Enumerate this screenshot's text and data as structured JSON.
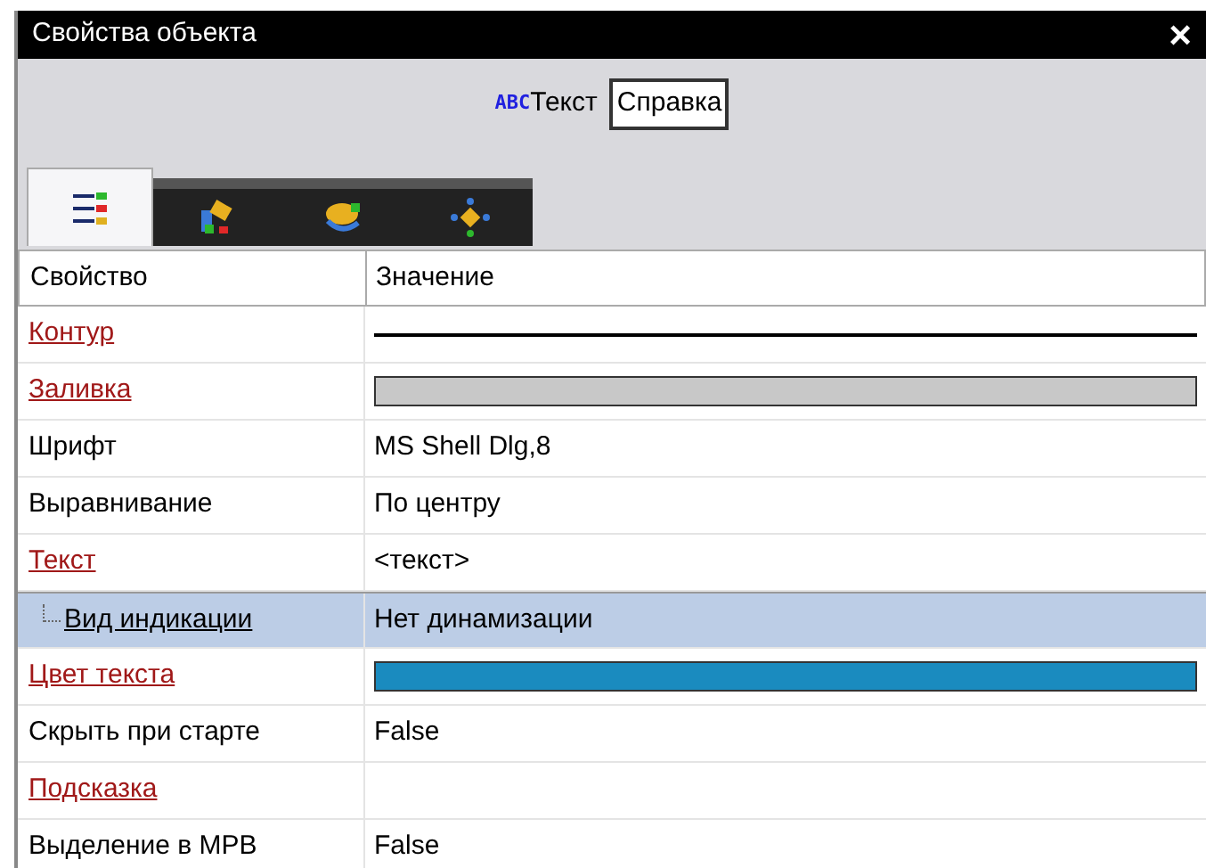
{
  "window": {
    "title": "Свойства объекта",
    "close": "×"
  },
  "toolbar": {
    "abc": "ABC",
    "text": "Текст",
    "help_button": "Справка"
  },
  "tabs": [
    {
      "selected": true
    },
    {
      "selected": false
    },
    {
      "selected": false
    },
    {
      "selected": false
    }
  ],
  "table": {
    "columns": [
      "Свойство",
      "Значение"
    ],
    "rows": [
      {
        "name": "Контур",
        "link": true,
        "kind": "line",
        "selected": false
      },
      {
        "name": "Заливка",
        "link": true,
        "kind": "swatch",
        "color": "#c8c8c8",
        "selected": false
      },
      {
        "name": "Шрифт",
        "link": false,
        "kind": "text",
        "value": "MS Shell Dlg,8",
        "selected": false
      },
      {
        "name": "Выравнивание",
        "link": false,
        "kind": "text",
        "value": "По центру",
        "selected": false
      },
      {
        "name": "Текст",
        "link": true,
        "kind": "text",
        "value": "<текст>",
        "selected": false,
        "children": [
          {
            "name": "Вид индикации",
            "link": true,
            "kind": "text",
            "value": "Нет динамизации",
            "selected": true
          }
        ]
      },
      {
        "name": "Цвет текста",
        "link": true,
        "kind": "swatch",
        "color": "#1a8bbf",
        "selected": false
      },
      {
        "name": "Скрыть при старте",
        "link": false,
        "kind": "text",
        "value": "False",
        "selected": false
      },
      {
        "name": "Подсказка",
        "link": true,
        "kind": "empty",
        "selected": false
      },
      {
        "name": "Выделение в МРВ",
        "link": false,
        "kind": "text",
        "value": "False",
        "selected": false
      }
    ]
  }
}
